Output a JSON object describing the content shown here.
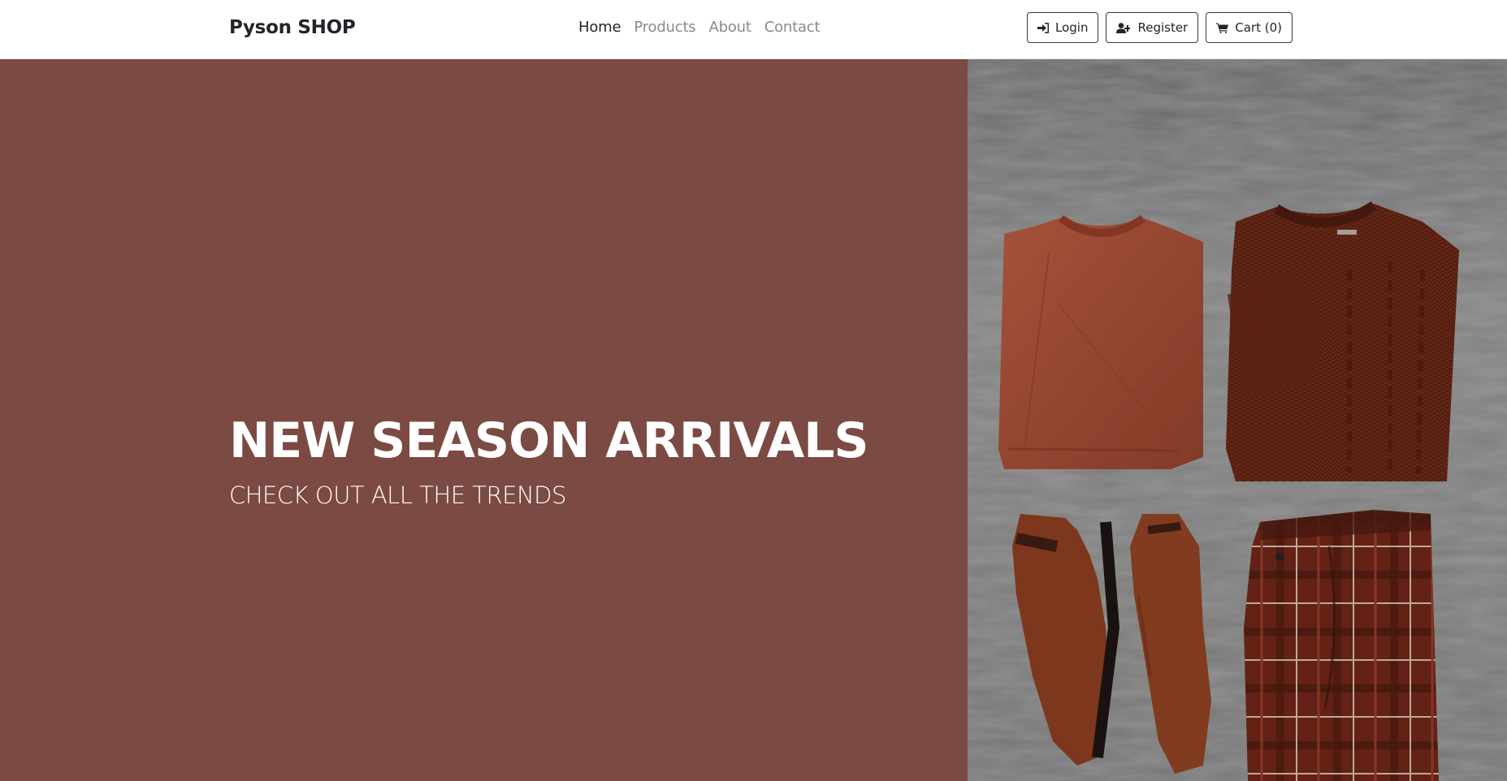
{
  "navbar": {
    "brand": "Pyson SHOP",
    "links": [
      {
        "label": "Home",
        "active": true
      },
      {
        "label": "Products",
        "active": false
      },
      {
        "label": "About",
        "active": false
      },
      {
        "label": "Contact",
        "active": false
      }
    ],
    "buttons": [
      {
        "label": "Login",
        "icon": "sign-in-icon"
      },
      {
        "label": "Register",
        "icon": "user-plus-icon"
      },
      {
        "label": "Cart (0)",
        "icon": "cart-icon"
      }
    ]
  },
  "hero": {
    "title": "NEW SEASON ARRIVALS",
    "subtitle": "CHECK OUT ALL THE TRENDS",
    "background_color": "#7b4a43",
    "image": "flat-lay clothing: rust sweatshirt, knit sweater, suede boots, plaid trousers on gray concrete"
  }
}
